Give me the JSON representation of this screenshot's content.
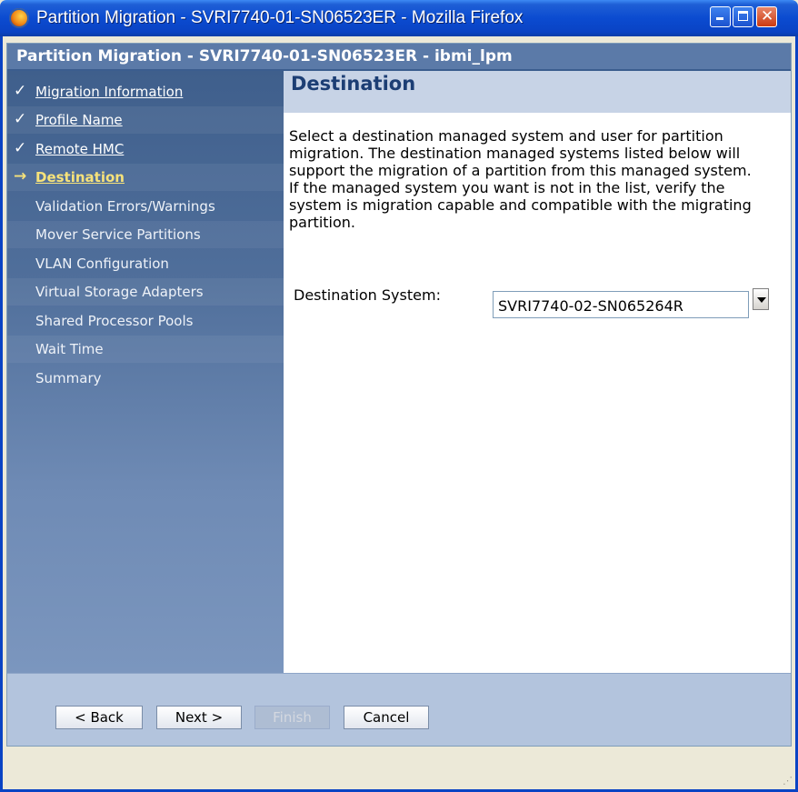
{
  "window": {
    "title": "Partition Migration - SVRI7740-01-SN06523ER - Mozilla Firefox"
  },
  "header": {
    "title": "Partition Migration - SVRI7740-01-SN06523ER - ibmi_lpm"
  },
  "nav": {
    "items": [
      {
        "label": "Migration Information",
        "state": "done",
        "mark": "✓"
      },
      {
        "label": "Profile Name",
        "state": "done",
        "mark": "✓"
      },
      {
        "label": "Remote HMC",
        "state": "done",
        "mark": "✓"
      },
      {
        "label": "Destination",
        "state": "current",
        "mark": "→"
      },
      {
        "label": "Validation Errors/Warnings",
        "state": "pending",
        "mark": ""
      },
      {
        "label": "Mover Service Partitions",
        "state": "pending",
        "mark": ""
      },
      {
        "label": "VLAN Configuration",
        "state": "pending",
        "mark": ""
      },
      {
        "label": "Virtual Storage Adapters",
        "state": "pending",
        "mark": ""
      },
      {
        "label": "Shared Processor Pools",
        "state": "pending",
        "mark": ""
      },
      {
        "label": "Wait Time",
        "state": "pending",
        "mark": ""
      },
      {
        "label": "Summary",
        "state": "pending",
        "mark": ""
      }
    ]
  },
  "main": {
    "heading": "Destination",
    "description": "Select a destination managed system and user for partition migration. The destination managed systems listed below will support the migration of a partition from this managed system. If the managed system you want is not in the list, verify the system is migration capable and compatible with the migrating partition.",
    "destination_label": "Destination System:",
    "destination_value": "SVRI7740-02-SN065264R"
  },
  "footer": {
    "back_label": "< Back",
    "next_label": "Next >",
    "finish_label": "Finish",
    "cancel_label": "Cancel"
  },
  "colors": {
    "titlebar": "#0a43c4",
    "nav_bg": "#506f9b",
    "current_step": "#f6e27a",
    "footer_bg": "#b3c4dd"
  }
}
